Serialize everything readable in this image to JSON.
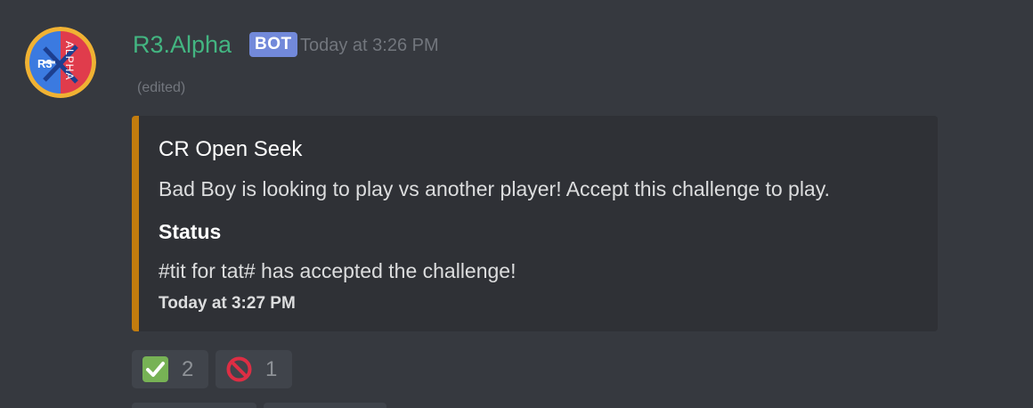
{
  "author": {
    "name": "R3.Alpha",
    "bot_tag": "BOT",
    "timestamp": "Today at 3:26 PM",
    "edited_label": "(edited)",
    "avatar": {
      "icon": "r3-alpha-logo",
      "left_text": "R3",
      "right_text": "ALPHA",
      "colors": {
        "left": "#3b7ae0",
        "right": "#e03c4c",
        "ring": "#f0b233"
      }
    },
    "name_color": "#43b581"
  },
  "embed": {
    "accent_color": "#c27c0e",
    "title": "CR Open Seek",
    "description": "Bad Boy is looking to play vs another player! Accept this challenge to play.",
    "field": {
      "name": "Status",
      "value": "#tit for tat# has accepted the challenge!"
    },
    "footer": "Today at 3:27 PM"
  },
  "reactions": [
    {
      "icon": "white-check-mark-icon",
      "count": "2"
    },
    {
      "icon": "no-entry-sign-icon",
      "count": "1"
    }
  ]
}
